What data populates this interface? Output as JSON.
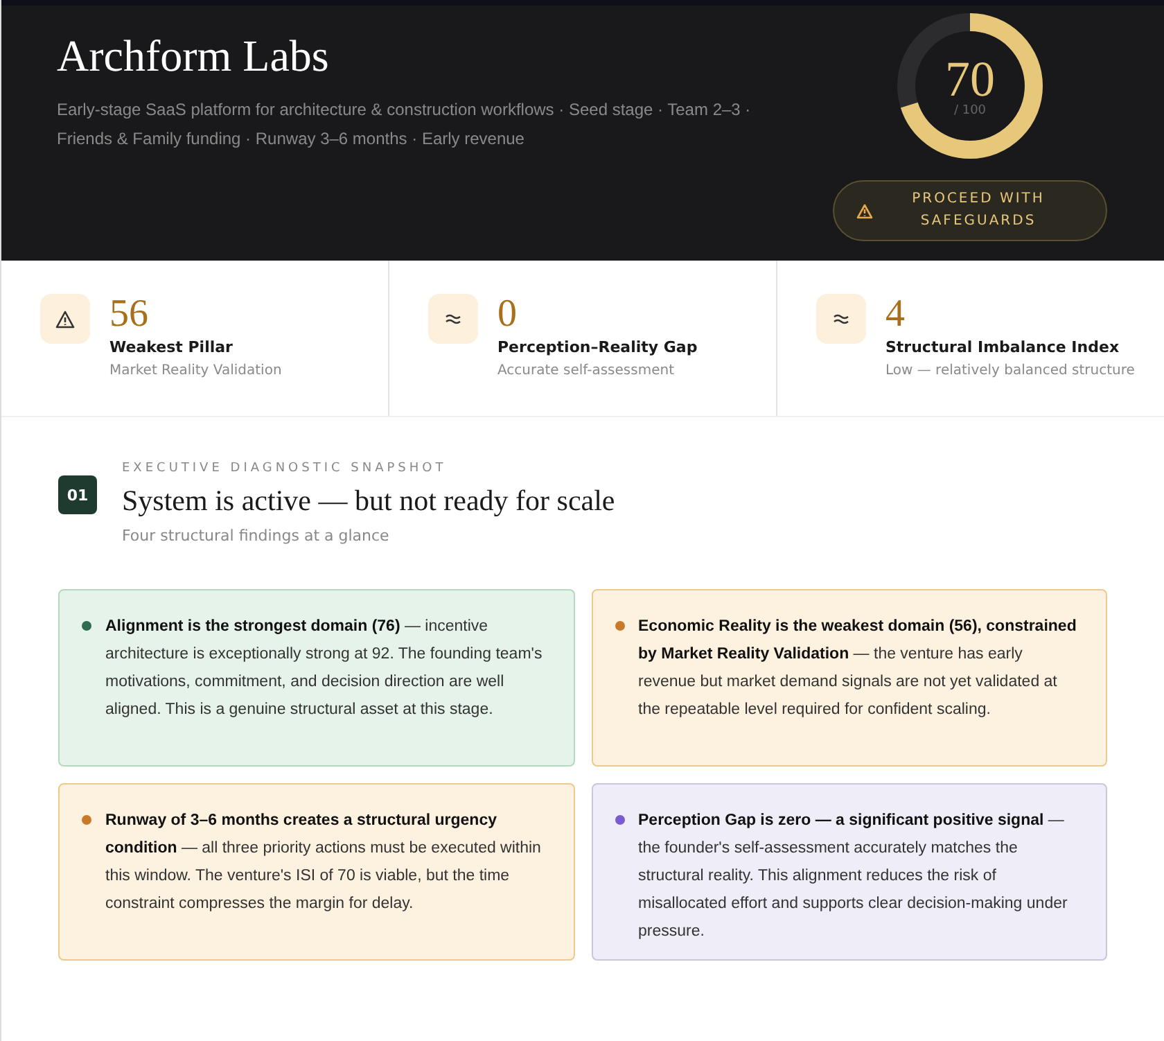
{
  "header": {
    "company": "Archform Labs",
    "description": "Early-stage SaaS platform for architecture & construction workflows · Seed stage · Team 2–3 · Friends & Family funding · Runway 3–6 months · Early revenue",
    "score": {
      "value": "70",
      "max": "/ 100",
      "level": 0.7
    },
    "verdict": "PROCEED WITH SAFEGUARDS"
  },
  "stats": [
    {
      "kind": "warning",
      "value": "56",
      "label": "Weakest Pillar",
      "caption": "Market Reality Validation"
    },
    {
      "kind": "approx",
      "value": "0",
      "label": "Perception–Reality Gap",
      "caption": "Accurate self-assessment"
    },
    {
      "kind": "approx",
      "value": "4",
      "label": "Structural Imbalance Index",
      "caption": "Low — relatively balanced structure"
    }
  ],
  "section": {
    "number": "01",
    "eyebrow": "EXECUTIVE DIAGNOSTIC SNAPSHOT",
    "title": "System is active — but not ready for scale",
    "subtitle": "Four structural findings at a glance",
    "findings": [
      {
        "kind": "strength",
        "color": "#2e6b4f",
        "text": "**Alignment is the strongest domain (76)** — incentive architecture is exceptionally strong at 92. The founding team's motivations, commitment, and decision direction are well aligned. This is a genuine structural asset at this stage."
      },
      {
        "kind": "risk",
        "color": "#c87a2a",
        "text": "**Economic Reality is the weakest domain (56), constrained by Market Reality Validation** — the venture has early revenue but market demand signals are not yet validated at the repeatable level required for confident scaling."
      },
      {
        "kind": "risk",
        "color": "#c87a2a",
        "text": "**Runway of 3–6 months creates a structural urgency condition** — all three priority actions must be executed within this window. The venture's ISI of 70 is viable, but the time constraint compresses the margin for delay."
      },
      {
        "kind": "signal",
        "color": "#7a5bd0",
        "text": "**Perception Gap is zero — a significant positive signal** — the founder's self-assessment accurately matches the structural reality. This alignment reduces the risk of misallocated effort and supports clear decision-making under pressure."
      }
    ]
  }
}
